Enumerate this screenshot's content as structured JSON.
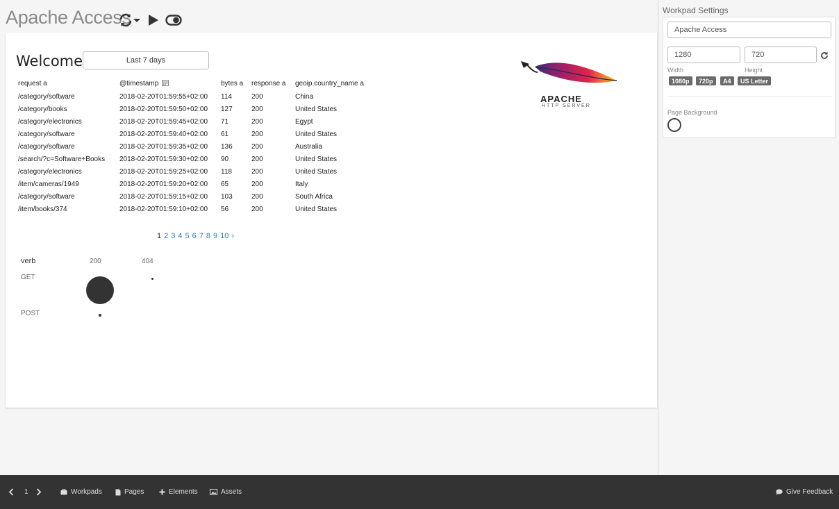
{
  "app": {
    "title": "Apache Access"
  },
  "header": {
    "icons": [
      "refresh-icon",
      "caret-down-icon",
      "play-icon",
      "toggle-icon"
    ]
  },
  "canvas": {
    "welcome": "Welcome!",
    "time_filter": "Last 7 days",
    "table": {
      "columns": [
        "request a",
        "@timestamp",
        "bytes a",
        "response a",
        "geoip.country_name a"
      ],
      "rows": [
        [
          "/category/software",
          "2018-02-20T01:59:55+02:00",
          "114",
          "200",
          "China"
        ],
        [
          "/category/books",
          "2018-02-20T01:59:50+02:00",
          "127",
          "200",
          "United States"
        ],
        [
          "/category/electronics",
          "2018-02-20T01:59:45+02:00",
          "71",
          "200",
          "Egypt"
        ],
        [
          "/category/software",
          "2018-02-20T01:59:40+02:00",
          "61",
          "200",
          "United States"
        ],
        [
          "/category/software",
          "2018-02-20T01:59:35+02:00",
          "136",
          "200",
          "Australia"
        ],
        [
          "/search/?c=Software+Books",
          "2018-02-20T01:59:30+02:00",
          "90",
          "200",
          "United States"
        ],
        [
          "/category/electronics",
          "2018-02-20T01:59:25+02:00",
          "118",
          "200",
          "United States"
        ],
        [
          "/item/cameras/1949",
          "2018-02-20T01:59:20+02:00",
          "65",
          "200",
          "Italy"
        ],
        [
          "/category/software",
          "2018-02-20T01:59:15+02:00",
          "103",
          "200",
          "South Africa"
        ],
        [
          "/item/books/374",
          "2018-02-20T01:59:10+02:00",
          "56",
          "200",
          "United States"
        ]
      ]
    },
    "pagination": {
      "current": "1",
      "pages": [
        "2",
        "3",
        "4",
        "5",
        "6",
        "7",
        "8",
        "9",
        "10"
      ],
      "next": "›"
    },
    "plot": {
      "row_header": "verb",
      "col_200": "200",
      "col_404": "404",
      "row_get": "GET",
      "row_post": "POST"
    },
    "logo": {
      "main": "APACHE",
      "sub": "HTTP SERVER"
    }
  },
  "settings": {
    "title": "Workpad Settings",
    "name_value": "Apache Access",
    "width_value": "1280",
    "height_value": "720",
    "width_label": "Width",
    "height_label": "Height",
    "presets": [
      "1080p",
      "720p",
      "A4",
      "US Letter"
    ],
    "background_label": "Page Background"
  },
  "footer": {
    "page_number": "1",
    "workpads": "Workpads",
    "pages": "Pages",
    "elements": "Elements",
    "assets": "Assets",
    "feedback": "Give Feedback"
  }
}
